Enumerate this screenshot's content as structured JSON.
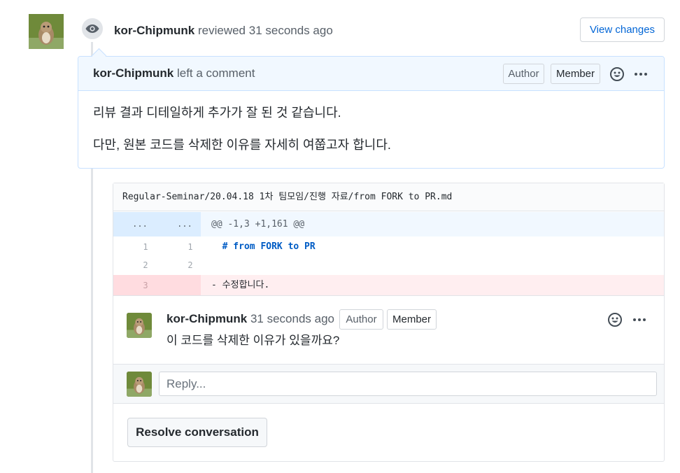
{
  "review": {
    "author": "kor-Chipmunk",
    "action": "reviewed",
    "time": "31 seconds ago",
    "view_changes_label": "View changes",
    "icon": "eye-icon"
  },
  "comment": {
    "author": "kor-Chipmunk",
    "action": "left a comment",
    "badges": {
      "author": "Author",
      "member": "Member"
    },
    "lines": [
      "리뷰 결과 디테일하게 추가가 잘 된 것 같습니다.",
      "다만, 원본 코드를 삭제한 이유를 자세히 여쭙고자 합니다."
    ]
  },
  "diff": {
    "file_path": "Regular-Seminar/20.04.18 1차 팀모임/진행 자료/from FORK to PR.md",
    "hunk": {
      "left": "...",
      "right": "...",
      "header": "@@ -1,3 +1,161 @@"
    },
    "rows": [
      {
        "old": "1",
        "new": "1",
        "code": "  # from FORK to PR",
        "type": "context"
      },
      {
        "old": "2",
        "new": "2",
        "code": "",
        "type": "context"
      },
      {
        "old": "3",
        "new": "",
        "code": "- 수정합니다.",
        "type": "deletion"
      }
    ]
  },
  "thread": {
    "author": "kor-Chipmunk",
    "time": "31 seconds ago",
    "badges": {
      "author": "Author",
      "member": "Member"
    },
    "text": "이 코드를 삭제한 이유가 있을까요?",
    "reply_placeholder": "Reply...",
    "resolve_label": "Resolve conversation"
  },
  "colors": {
    "link": "#0366d6",
    "comment_header_bg": "#f1f8ff",
    "deletion_bg": "#ffeef0",
    "code_keyword": "#005cc5"
  }
}
